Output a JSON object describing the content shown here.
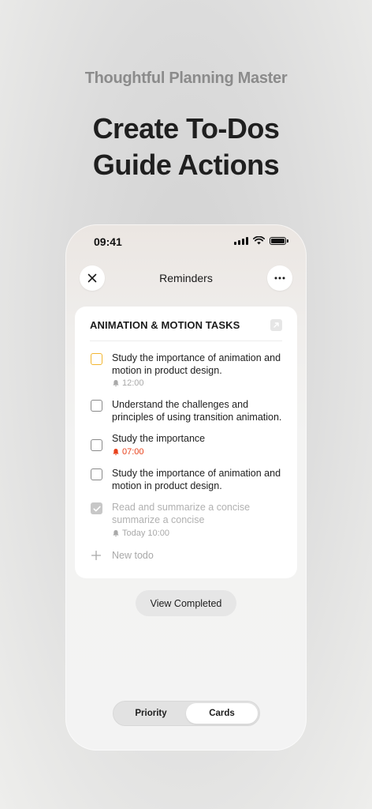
{
  "promo": {
    "tagline": "Thoughtful Planning Master",
    "headline_line1": "Create To-Dos",
    "headline_line2": "Guide Actions"
  },
  "status_bar": {
    "time": "09:41",
    "icons": [
      "cellular-signal-icon",
      "wifi-icon",
      "battery-icon"
    ]
  },
  "nav": {
    "title": "Reminders",
    "left_icon": "close-icon",
    "right_icon": "more-icon"
  },
  "list": {
    "title": "ANIMATION & MOTION TASKS",
    "expand_icon": "expand-icon",
    "todos": [
      {
        "text": "Study the importance of animation and motion in product design.",
        "state": "active",
        "reminder": "12:00",
        "reminder_status": "normal"
      },
      {
        "text": "Understand the challenges and principles of using transition animation.",
        "state": "unchecked"
      },
      {
        "text": "Study the importance",
        "state": "unchecked",
        "reminder": "07:00",
        "reminder_status": "overdue"
      },
      {
        "text": "Study the importance of animation and motion in product design.",
        "state": "unchecked"
      },
      {
        "text": "Read and summarize a concise summarize a concise",
        "state": "checked",
        "reminder": "Today 10:00",
        "reminder_status": "normal"
      }
    ],
    "new_todo_placeholder": "New todo"
  },
  "actions": {
    "view_completed": "View Completed"
  },
  "view_switch": {
    "options": [
      "Priority",
      "Cards"
    ],
    "selected": "Cards"
  },
  "colors": {
    "active_checkbox": "#f2b630",
    "overdue": "#e8421c",
    "muted": "#a9a9a9"
  }
}
